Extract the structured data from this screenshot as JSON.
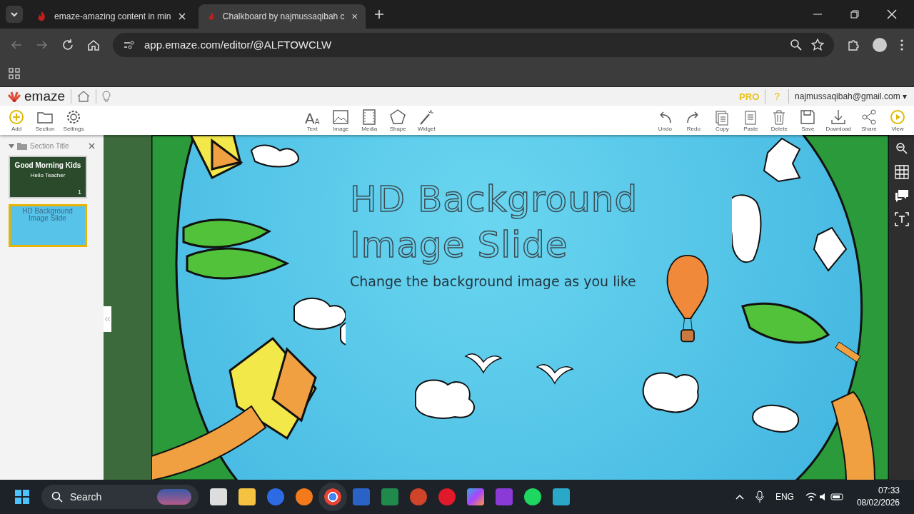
{
  "browser": {
    "tabs": [
      {
        "title": "emaze-amazing content in min",
        "selected": false
      },
      {
        "title": "Chalkboard by najmussaqibah c",
        "selected": true
      }
    ],
    "url": "app.emaze.com/editor/@ALFTOWCLW"
  },
  "app_header": {
    "logo": "emaze",
    "pro": "PRO",
    "help": "?",
    "account": "najmussaqibah@gmail.com ▾"
  },
  "toolbar": {
    "text_tool_glyphs": [
      "A",
      "A"
    ],
    "left": [
      "Add",
      "Section",
      "Settings"
    ],
    "center": [
      "Text",
      "Image",
      "Media",
      "Shape",
      "Widget"
    ],
    "right": [
      "Undo",
      "Redo",
      "Copy",
      "Paste",
      "Delete",
      "Save",
      "Download",
      "Share",
      "View"
    ]
  },
  "sidebar": {
    "section_title": "Section Title",
    "slides": [
      {
        "title": "Good Morning Kids",
        "caption": "Hello Teacher",
        "number": "1",
        "selected": false
      },
      {
        "title": "HD Background Image Slide",
        "selected": true
      }
    ]
  },
  "slide": {
    "title_lines": [
      "HD Background",
      "Image Slide"
    ],
    "subtitle": "Change the background image as you like"
  },
  "taskbar": {
    "search": "Search",
    "language": "ENG",
    "time": "07:33",
    "date": "08/02/2026"
  }
}
